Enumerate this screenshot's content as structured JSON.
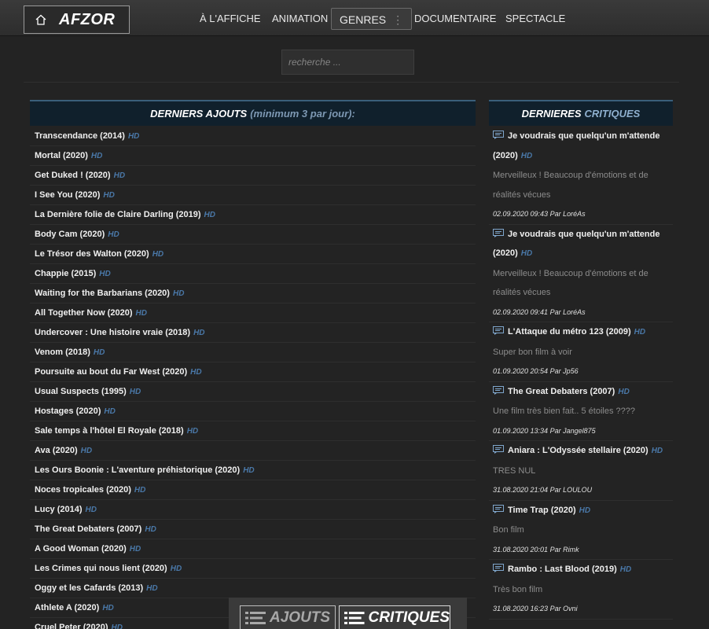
{
  "header": {
    "brand": "AFZOR",
    "nav": [
      {
        "label": "À L'AFFICHE"
      },
      {
        "label": "ANIMATION"
      },
      {
        "label": "GENRES",
        "has_menu": true,
        "menu_glyph": "⋮"
      },
      {
        "label": "DOCUMENTAIRE"
      },
      {
        "label": "SPECTACLE"
      }
    ]
  },
  "search": {
    "placeholder": "recherche ..."
  },
  "latest": {
    "title": "DERNIERS AJOUTS",
    "subtitle": "(minimum 3 par jour):",
    "badge": "HD",
    "items": [
      "Transcendance (2014)",
      "Mortal (2020)",
      "Get Duked ! (2020)",
      "I See You (2020)",
      "La Dernière folie de Claire Darling (2019)",
      "Body Cam (2020)",
      "Le Trésor des Walton (2020)",
      "Chappie (2015)",
      "Waiting for the Barbarians (2020)",
      "All Together Now (2020)",
      "Undercover : Une histoire vraie (2018)",
      "Venom (2018)",
      "Poursuite au bout du Far West (2020)",
      "Usual Suspects (1995)",
      "Hostages (2020)",
      "Sale temps à l'hôtel El Royale (2018)",
      "Ava (2020)",
      "Les Ours Boonie : L'aventure préhistorique (2020)",
      "Noces tropicales (2020)",
      "Lucy (2014)",
      "The Great Debaters (2007)",
      "A Good Woman (2020)",
      "Les Crimes qui nous lient (2020)",
      "Oggy et les Cafards (2013)",
      "Athlete A (2020)",
      "Cruel Peter (2020)"
    ]
  },
  "reviews": {
    "title_a": "DERNIERES",
    "title_b": "CRITIQUES",
    "badge": "HD",
    "items": [
      {
        "title": "Je voudrais que quelqu'un m'attende (2020)",
        "text": "Merveilleux ! Beaucoup d'émotions et de réalités vécues",
        "meta": "02.09.2020 09:43 Par LoréAs"
      },
      {
        "title": "Je voudrais que quelqu'un m'attende (2020)",
        "text": "Merveilleux ! Beaucoup d'émotions et de réalités vécues",
        "meta": "02.09.2020 09:41 Par LoréAs"
      },
      {
        "title": "L'Attaque du métro 123 (2009)",
        "text": "Super bon film à voir",
        "meta": "01.09.2020 20:54 Par Jp56"
      },
      {
        "title": "The Great Debaters (2007)",
        "text": "Une film très bien fait.. 5 étoiles ????",
        "meta": "01.09.2020 13:34 Par Jangel875"
      },
      {
        "title": "Aniara : L'Odyssée stellaire (2020)",
        "text": "TRES NUL",
        "meta": "31.08.2020 21:04 Par LOULOU"
      },
      {
        "title": "Time Trap (2020)",
        "text": "Bon film",
        "meta": "31.08.2020 20:01 Par Rimk"
      },
      {
        "title": "Rambo : Last Blood (2019)",
        "text": "Très bon film",
        "meta": "31.08.2020 16:23 Par Ovni"
      }
    ]
  },
  "bottom_tabs": {
    "ajouts": "AJOUTS",
    "critiques": "CRITIQUES"
  },
  "colors": {
    "background": "#232323",
    "panel_header": "#10202c",
    "hd_badge": "#4a78a8"
  },
  "icons": {
    "home": "home-icon",
    "review": "comment-icon",
    "list": "list-icon"
  }
}
